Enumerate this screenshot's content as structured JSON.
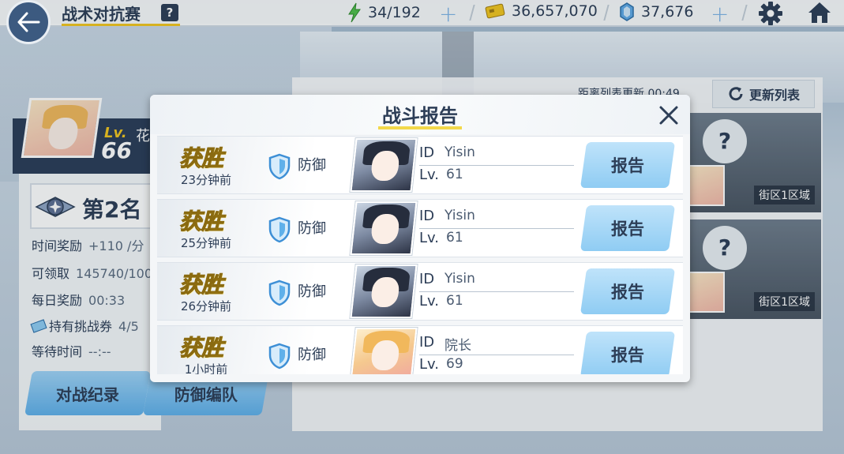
{
  "header": {
    "title": "战术对抗赛",
    "help": "?",
    "stamina": "34/192",
    "credits": "36,657,070",
    "gems": "37,676"
  },
  "left_panel": {
    "lv_label": "Lv.",
    "level": "66",
    "name_fragment": "花",
    "rank": "第2名",
    "time_reward_label": "时间奖励",
    "time_reward_value": "+110 /分",
    "claimable_label": "可领取",
    "claimable_value": "145740/100",
    "daily_reward_label": "每日奖励",
    "daily_reward_value": "00:33",
    "tickets_label": "持有挑战券",
    "tickets_value": "4/5",
    "wait_label": "等待时间",
    "wait_value": "--:--",
    "battle_record_button": "对战纪录",
    "defense_team_button": "防御编队"
  },
  "right_panel": {
    "refresh_countdown": "距离列表更新 00:49",
    "refresh_button": "更新列表",
    "opponents": [
      {
        "mark": "?",
        "region": "街区1区域"
      },
      {
        "mark": "?",
        "region": "街区1区域"
      }
    ]
  },
  "modal": {
    "title": "战斗报告",
    "reports": [
      {
        "result": "获胜",
        "time": "23分钟前",
        "type": "防御",
        "id_label": "ID",
        "opponent_id": "Yisin",
        "lv_label": "Lv.",
        "level": "61",
        "button": "报告",
        "avatar": "dark"
      },
      {
        "result": "获胜",
        "time": "25分钟前",
        "type": "防御",
        "id_label": "ID",
        "opponent_id": "Yisin",
        "lv_label": "Lv.",
        "level": "61",
        "button": "报告",
        "avatar": "dark"
      },
      {
        "result": "获胜",
        "time": "26分钟前",
        "type": "防御",
        "id_label": "ID",
        "opponent_id": "Yisin",
        "lv_label": "Lv.",
        "level": "61",
        "button": "报告",
        "avatar": "dark"
      },
      {
        "result": "获胜",
        "time": "1小时前",
        "type": "防御",
        "id_label": "ID",
        "opponent_id": "院长",
        "lv_label": "Lv.",
        "level": "69",
        "button": "报告",
        "avatar": "blonde"
      }
    ]
  },
  "colors": {
    "navy": "#2d3e57",
    "accent_yellow": "#f2c51f",
    "button_blue": "#8fccf3",
    "plus_blue": "#7fb4e6"
  },
  "icons": [
    "back-arrow-icon",
    "help-icon",
    "stamina-bolt-icon",
    "credit-card-icon",
    "gem-icon",
    "gear-icon",
    "home-icon",
    "close-icon",
    "defense-shield-icon",
    "refresh-icon",
    "rank-emblem-icon",
    "ticket-icon"
  ]
}
